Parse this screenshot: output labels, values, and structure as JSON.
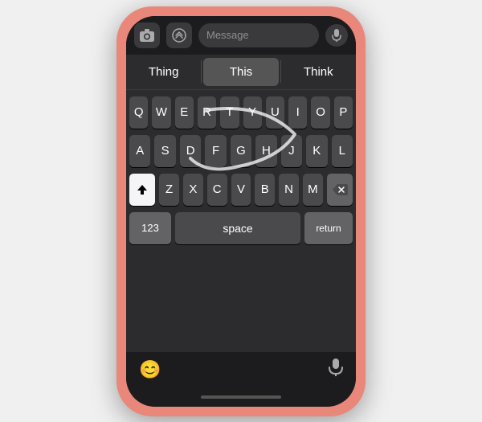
{
  "phone": {
    "message_placeholder": "Message",
    "autocomplete": {
      "left": "Thing",
      "center": "This",
      "right": "Think"
    },
    "keyboard": {
      "row1": [
        "Q",
        "W",
        "E",
        "R",
        "T",
        "Y",
        "U",
        "I",
        "O",
        "P"
      ],
      "row2": [
        "A",
        "S",
        "D",
        "F",
        "G",
        "H",
        "J",
        "K",
        "L"
      ],
      "row3": [
        "Z",
        "X",
        "C",
        "V",
        "B",
        "N",
        "M"
      ],
      "bottom": {
        "num": "123",
        "space": "space",
        "return": "return"
      }
    },
    "bottom_dock": {
      "emoji_icon": "😊",
      "mic_icon": "🎤"
    }
  }
}
